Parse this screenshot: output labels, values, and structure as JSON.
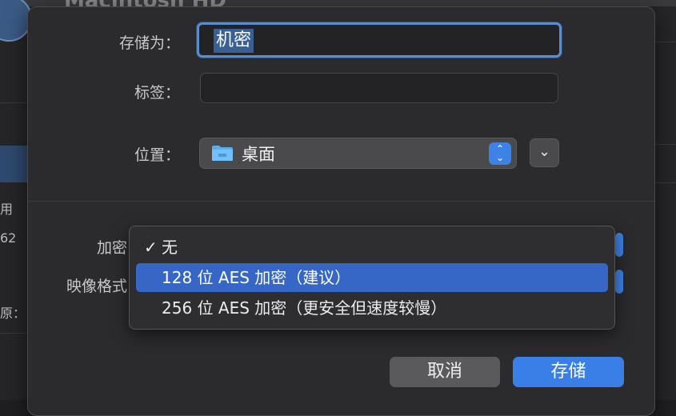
{
  "background": {
    "title": "Macintosh HD",
    "side_texts": [
      "用",
      "62",
      "原："
    ]
  },
  "dialog": {
    "save_as_label": "存储为：",
    "save_as_value": "机密",
    "tags_label": "标签：",
    "tags_value": "",
    "location_label": "位置：",
    "location_value": "桌面",
    "encryption_label": "加密",
    "image_format_label": "映像格式"
  },
  "encryption_menu": {
    "items": [
      {
        "label": "无",
        "checked": true
      },
      {
        "label": "128 位 AES 加密（建议）",
        "highlighted": true
      },
      {
        "label": "256 位 AES 加密（更安全但速度较慢）"
      }
    ]
  },
  "buttons": {
    "cancel": "取消",
    "save": "存储"
  },
  "icons": {
    "check": "checkmark-icon",
    "folder": "folder-icon",
    "stepper": "up-down-chevron-icon",
    "expand": "chevron-down-icon"
  },
  "colors": {
    "accent": "#3a7ee8",
    "selection": "#3667c7"
  }
}
